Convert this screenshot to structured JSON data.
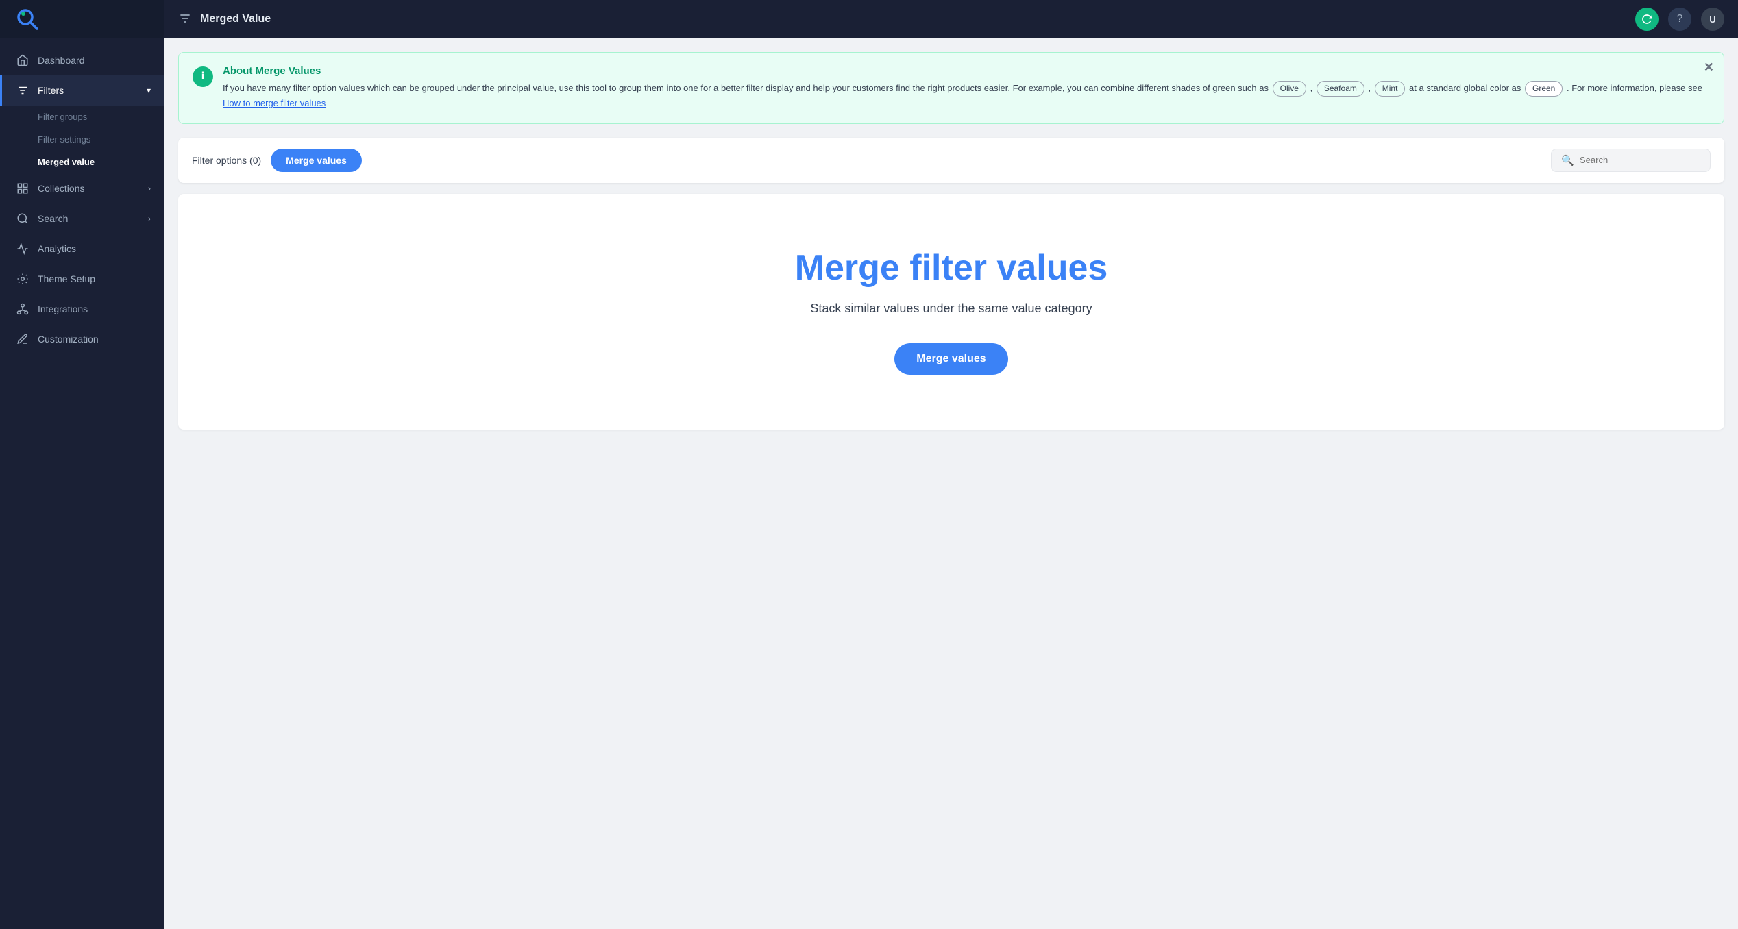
{
  "app": {
    "title": "Merged Value",
    "logo_alt": "SearchPie"
  },
  "topbar": {
    "title": "Merged Value",
    "refresh_label": "↺",
    "help_label": "?",
    "avatar_label": "U"
  },
  "sidebar": {
    "nav_items": [
      {
        "id": "dashboard",
        "label": "Dashboard",
        "icon": "home-icon",
        "active": false
      },
      {
        "id": "filters",
        "label": "Filters",
        "icon": "filter-icon",
        "active": true,
        "has_chevron": true
      },
      {
        "id": "collections",
        "label": "Collections",
        "icon": "collections-icon",
        "active": false,
        "has_chevron": true
      },
      {
        "id": "search",
        "label": "Search",
        "icon": "search-icon",
        "active": false,
        "has_chevron": true
      },
      {
        "id": "analytics",
        "label": "Analytics",
        "icon": "analytics-icon",
        "active": false
      },
      {
        "id": "theme-setup",
        "label": "Theme Setup",
        "icon": "theme-icon",
        "active": false
      },
      {
        "id": "integrations",
        "label": "Integrations",
        "icon": "integrations-icon",
        "active": false
      },
      {
        "id": "customization",
        "label": "Customization",
        "icon": "customization-icon",
        "active": false
      }
    ],
    "sub_items": [
      {
        "id": "filter-groups",
        "label": "Filter groups",
        "active": false
      },
      {
        "id": "filter-settings",
        "label": "Filter settings",
        "active": false
      },
      {
        "id": "merged-value",
        "label": "Merged value",
        "active": true
      }
    ]
  },
  "banner": {
    "title": "About Merge Values",
    "body_part1": "If you have many filter option values which can be grouped under the principal value, use this tool to group them into one for a better filter display and help your customers find the right products easier. For example, you can combine different shades of green such as",
    "tags": [
      "Olive",
      "Seafoam",
      "Mint"
    ],
    "body_part2": "at a standard global color as",
    "global_tag": "Green",
    "body_part3": ". For more information, please see",
    "link_text": "How to merge filter values"
  },
  "tabs": {
    "filter_options_label": "Filter options (0)",
    "merge_button_label": "Merge values",
    "search_placeholder": "Search"
  },
  "empty_state": {
    "title": "Merge filter values",
    "subtitle": "Stack similar values under the same value category",
    "button_label": "Merge values"
  }
}
